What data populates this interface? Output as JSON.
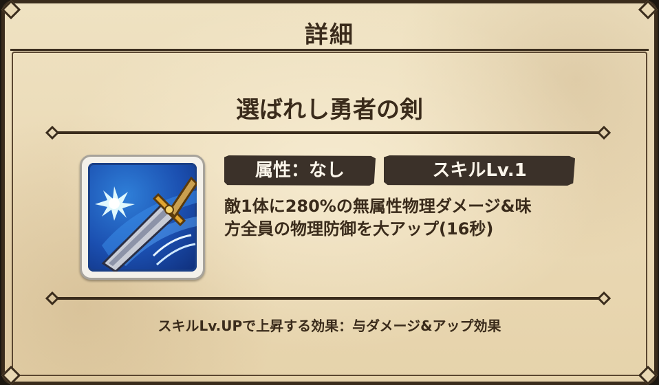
{
  "header": {
    "title": "詳細"
  },
  "skill": {
    "name": "選ばれし勇者の剣",
    "icon": "sword-icon",
    "attribute_label": "属性：なし",
    "level_label": "スキルLv.1",
    "description_line1": "敵1体に280%の無属性物理ダメージ&味",
    "description_line2": "方全員の物理防御を大アップ(16秒)"
  },
  "footer": {
    "levelup_effect": "スキルLv.UPで上昇する効果：与ダメージ&アップ効果"
  },
  "colors": {
    "parchment": "#ead9b5",
    "ink": "#3a2b1b",
    "tag_bg": "#3b3129",
    "icon_blue": "#1b4fb0"
  }
}
